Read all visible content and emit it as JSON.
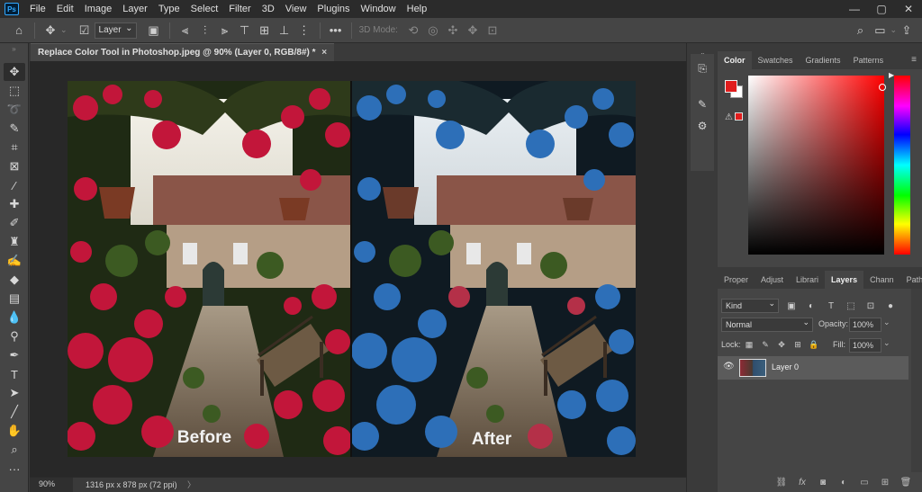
{
  "menubar": {
    "logo": "Ps",
    "items": [
      "File",
      "Edit",
      "Image",
      "Layer",
      "Type",
      "Select",
      "Filter",
      "3D",
      "View",
      "Plugins",
      "Window",
      "Help"
    ],
    "window_controls": [
      "—",
      "▢",
      "✕"
    ]
  },
  "optionsbar": {
    "auto_select_value": "Layer",
    "mode_3d_label": "3D Mode:"
  },
  "document": {
    "tab_title": "Replace Color Tool in Photoshop.jpeg @ 90% (Layer 0, RGB/8#) *",
    "close_glyph": "×",
    "zoom": "90%",
    "info": "1316 px x 878 px (72 ppi)",
    "info_arrow": "〉"
  },
  "artwork": {
    "before_label": "Before",
    "after_label": "After"
  },
  "color_panel": {
    "tabs": [
      "Color",
      "Swatches",
      "Gradients",
      "Patterns"
    ],
    "active_tab": "Color",
    "foreground_color": "#e11d1d",
    "background_color": "#ffffff"
  },
  "layers_panel": {
    "tabs": [
      "Proper",
      "Adjust",
      "Librari",
      "Layers",
      "Chann",
      "Paths"
    ],
    "active_tab": "Layers",
    "filter_kind": "Kind",
    "blend_mode": "Normal",
    "opacity_label": "Opacity:",
    "opacity_value": "100%",
    "lock_label": "Lock:",
    "fill_label": "Fill:",
    "fill_value": "100%",
    "layers": [
      {
        "name": "Layer 0",
        "visible": true
      }
    ]
  },
  "tools": [
    "move",
    "marquee",
    "lasso",
    "quick-select",
    "crop",
    "frame",
    "eyedropper",
    "healing",
    "brush",
    "clone-stamp",
    "history-brush",
    "eraser",
    "gradient",
    "blur",
    "dodge",
    "pen",
    "type",
    "path-select",
    "shape",
    "hand",
    "zoom",
    "more"
  ]
}
